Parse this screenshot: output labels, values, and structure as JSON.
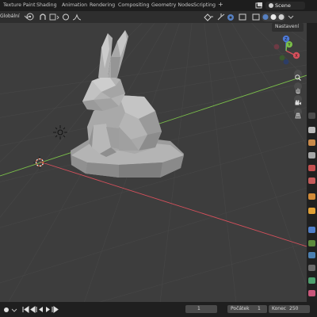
{
  "header": {
    "tabs": [
      "Texture Paint",
      "Shading",
      "Animation",
      "Rendering",
      "Compositing",
      "Geometry Nodes",
      "Scripting"
    ],
    "add_tab_label": "+",
    "scene_label": "Scene"
  },
  "toolbar": {
    "orientation_label": "Globální",
    "options_label": "Nastavení"
  },
  "viewport": {
    "object": "low-poly bunny"
  },
  "timeline": {
    "current_frame": "1",
    "start_label": "Počátek",
    "start_value": "1",
    "end_label": "Konec",
    "end_value": "250"
  },
  "icons": [
    "view-gizmo-icon",
    "zoom-icon",
    "pan-hand-icon",
    "camera-icon",
    "grid-view-icon",
    "cursor-icon",
    "light-icon",
    "play-icon",
    "record-icon"
  ],
  "colors": {
    "axis_x": "#d6505c",
    "axis_y": "#7bc04a",
    "axis_z": "#4d78d6",
    "accent": "#4772b3"
  }
}
